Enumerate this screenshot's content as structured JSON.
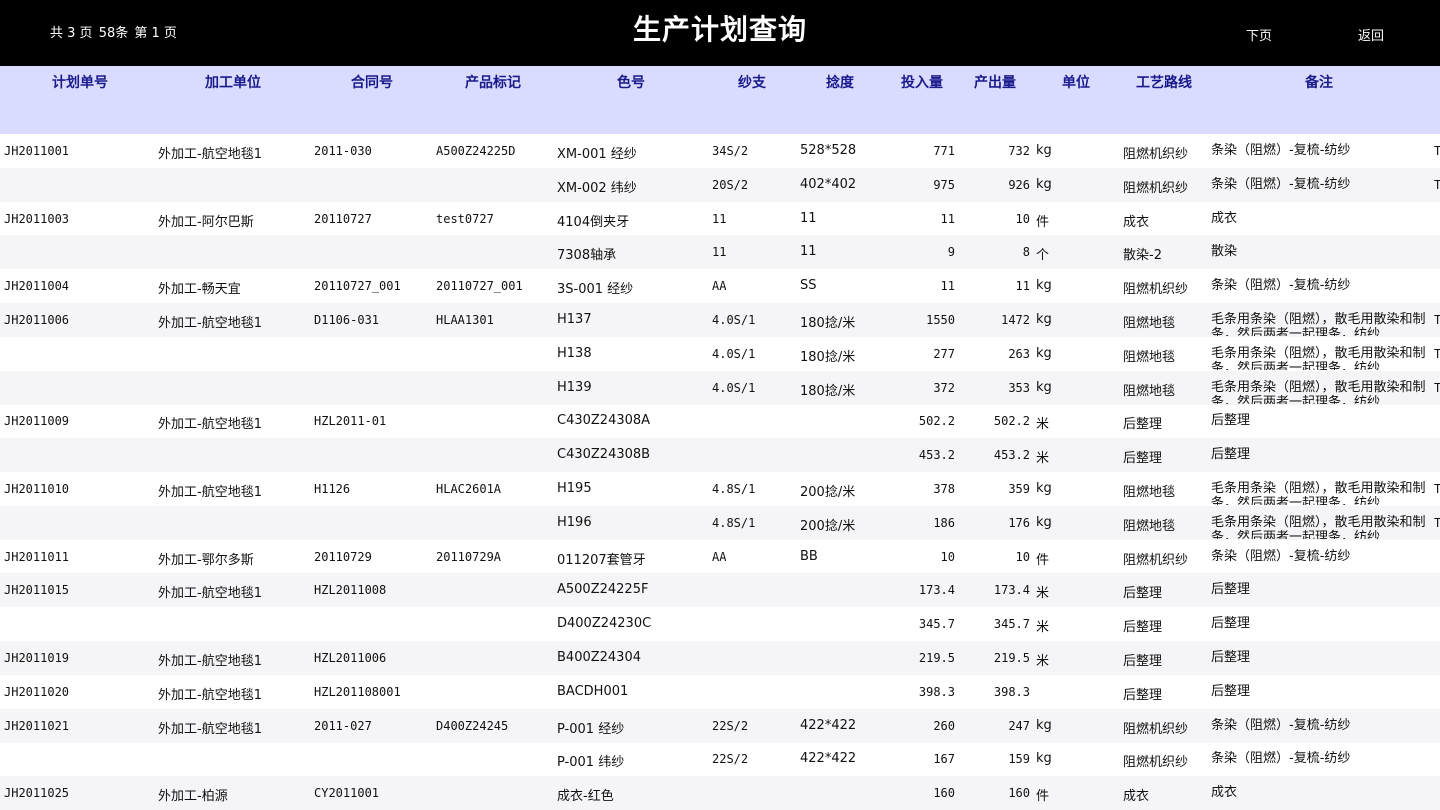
{
  "topbar": {
    "page_info_total": "共 3 页",
    "page_info_count": "58条",
    "page_info_current": "第 1 页",
    "title": "生产计划查询",
    "next_label": "下页",
    "back_label": "返回"
  },
  "columns": [
    "计划单号",
    "加工单位",
    "合同号",
    "产品标记",
    "色号",
    "纱支",
    "捻度",
    "投入量",
    "产出量",
    "单位",
    "工艺路线",
    "备注"
  ],
  "rows": [
    {
      "plan": "JH2011001",
      "unit": "外加工-航空地毯1",
      "contract": "2011-030",
      "mark": "A500Z24225D",
      "color": "XM-001 经纱",
      "yarn": "34S/2",
      "twist": "528*528",
      "input": "771",
      "output": "732",
      "uom": "kg",
      "route": "阻燃机织纱",
      "remark": "条染（阻燃）-复梳-纺纱",
      "tail": "T",
      "alt": false
    },
    {
      "plan": "",
      "unit": "",
      "contract": "",
      "mark": "",
      "color": "XM-002 纬纱",
      "yarn": "20S/2",
      "twist": "402*402",
      "input": "975",
      "output": "926",
      "uom": "kg",
      "route": "阻燃机织纱",
      "remark": "条染（阻燃）-复梳-纺纱",
      "tail": "T",
      "alt": true
    },
    {
      "plan": "JH2011003",
      "unit": "外加工-阿尔巴斯",
      "contract": "20110727",
      "mark": "test0727",
      "color": "4104倒夹牙",
      "yarn": "11",
      "twist": "11",
      "input": "11",
      "output": "10",
      "uom": "件",
      "route": "成衣",
      "remark": "成衣",
      "tail": "",
      "alt": false
    },
    {
      "plan": "",
      "unit": "",
      "contract": "",
      "mark": "",
      "color": "7308轴承",
      "yarn": "11",
      "twist": "11",
      "input": "9",
      "output": "8",
      "uom": "个",
      "route": "散染-2",
      "remark": "散染",
      "tail": "",
      "alt": true
    },
    {
      "plan": "JH2011004",
      "unit": "外加工-畅天宜",
      "contract": "20110727_001",
      "mark": "20110727_001",
      "color": "3S-001 经纱",
      "yarn": "AA",
      "twist": "SS",
      "input": "11",
      "output": "11",
      "uom": "kg",
      "route": "阻燃机织纱",
      "remark": "条染（阻燃）-复梳-纺纱",
      "tail": "",
      "alt": false
    },
    {
      "plan": "JH2011006",
      "unit": "外加工-航空地毯1",
      "contract": "D1106-031",
      "mark": "HLAA1301",
      "color": "H137",
      "yarn": "4.0S/1",
      "twist": "180捻/米",
      "input": "1550",
      "output": "1472",
      "uom": "kg",
      "route": "阻燃地毯",
      "remark": "毛条用条染（阻燃），散毛用散染和制条，然后两者一起理条，纺纱",
      "tail": "T",
      "alt": true
    },
    {
      "plan": "",
      "unit": "",
      "contract": "",
      "mark": "",
      "color": "H138",
      "yarn": "4.0S/1",
      "twist": "180捻/米",
      "input": "277",
      "output": "263",
      "uom": "kg",
      "route": "阻燃地毯",
      "remark": "毛条用条染（阻燃），散毛用散染和制条，然后两者一起理条，纺纱",
      "tail": "T",
      "alt": false
    },
    {
      "plan": "",
      "unit": "",
      "contract": "",
      "mark": "",
      "color": "H139",
      "yarn": "4.0S/1",
      "twist": "180捻/米",
      "input": "372",
      "output": "353",
      "uom": "kg",
      "route": "阻燃地毯",
      "remark": "毛条用条染（阻燃），散毛用散染和制条，然后两者一起理条，纺纱",
      "tail": "T",
      "alt": true
    },
    {
      "plan": "JH2011009",
      "unit": "外加工-航空地毯1",
      "contract": "HZL2011-01",
      "mark": "",
      "color": "C430Z24308A",
      "yarn": "",
      "twist": "",
      "input": "502.2",
      "output": "502.2",
      "uom": "米",
      "route": "后整理",
      "remark": "后整理",
      "tail": "",
      "alt": false
    },
    {
      "plan": "",
      "unit": "",
      "contract": "",
      "mark": "",
      "color": "C430Z24308B",
      "yarn": "",
      "twist": "",
      "input": "453.2",
      "output": "453.2",
      "uom": "米",
      "route": "后整理",
      "remark": "后整理",
      "tail": "",
      "alt": true
    },
    {
      "plan": "JH2011010",
      "unit": "外加工-航空地毯1",
      "contract": "H1126",
      "mark": "HLAC2601A",
      "color": "H195",
      "yarn": "4.8S/1",
      "twist": "200捻/米",
      "input": "378",
      "output": "359",
      "uom": "kg",
      "route": "阻燃地毯",
      "remark": "毛条用条染（阻燃），散毛用散染和制条，然后两者一起理条，纺纱",
      "tail": "T",
      "alt": false
    },
    {
      "plan": "",
      "unit": "",
      "contract": "",
      "mark": "",
      "color": "H196",
      "yarn": "4.8S/1",
      "twist": "200捻/米",
      "input": "186",
      "output": "176",
      "uom": "kg",
      "route": "阻燃地毯",
      "remark": "毛条用条染（阻燃），散毛用散染和制条，然后两者一起理条，纺纱",
      "tail": "T",
      "alt": true
    },
    {
      "plan": "JH2011011",
      "unit": "外加工-鄂尔多斯",
      "contract": "20110729",
      "mark": "20110729A",
      "color": "011207套管牙",
      "yarn": "AA",
      "twist": "BB",
      "input": "10",
      "output": "10",
      "uom": "件",
      "route": "阻燃机织纱",
      "remark": "条染（阻燃）-复梳-纺纱",
      "tail": "",
      "alt": false
    },
    {
      "plan": "JH2011015",
      "unit": "外加工-航空地毯1",
      "contract": "HZL2011008",
      "mark": "",
      "color": "A500Z24225F",
      "yarn": "",
      "twist": "",
      "input": "173.4",
      "output": "173.4",
      "uom": "米",
      "route": "后整理",
      "remark": "后整理",
      "tail": "",
      "alt": true
    },
    {
      "plan": "",
      "unit": "",
      "contract": "",
      "mark": "",
      "color": "D400Z24230C",
      "yarn": "",
      "twist": "",
      "input": "345.7",
      "output": "345.7",
      "uom": "米",
      "route": "后整理",
      "remark": "后整理",
      "tail": "",
      "alt": false
    },
    {
      "plan": "JH2011019",
      "unit": "外加工-航空地毯1",
      "contract": "HZL2011006",
      "mark": "",
      "color": "B400Z24304",
      "yarn": "",
      "twist": "",
      "input": "219.5",
      "output": "219.5",
      "uom": "米",
      "route": "后整理",
      "remark": "后整理",
      "tail": "",
      "alt": true
    },
    {
      "plan": "JH2011020",
      "unit": "外加工-航空地毯1",
      "contract": "HZL201108001",
      "mark": "",
      "color": "BACDH001",
      "yarn": "",
      "twist": "",
      "input": "398.3",
      "output": "398.3",
      "uom": "",
      "route": "后整理",
      "remark": "后整理",
      "tail": "",
      "alt": false
    },
    {
      "plan": "JH2011021",
      "unit": "外加工-航空地毯1",
      "contract": "2011-027",
      "mark": "D400Z24245",
      "color": "P-001 经纱",
      "yarn": "22S/2",
      "twist": "422*422",
      "input": "260",
      "output": "247",
      "uom": "kg",
      "route": "阻燃机织纱",
      "remark": "条染（阻燃）-复梳-纺纱",
      "tail": "",
      "alt": true
    },
    {
      "plan": "",
      "unit": "",
      "contract": "",
      "mark": "",
      "color": "P-001 纬纱",
      "yarn": "22S/2",
      "twist": "422*422",
      "input": "167",
      "output": "159",
      "uom": "kg",
      "route": "阻燃机织纱",
      "remark": "条染（阻燃）-复梳-纺纱",
      "tail": "",
      "alt": false
    },
    {
      "plan": "JH2011025",
      "unit": "外加工-柏源",
      "contract": "CY2011001",
      "mark": "",
      "color": "成衣-红色",
      "yarn": "",
      "twist": "",
      "input": "160",
      "output": "160",
      "uom": "件",
      "route": "成衣",
      "remark": "成衣",
      "tail": "",
      "alt": true
    }
  ]
}
